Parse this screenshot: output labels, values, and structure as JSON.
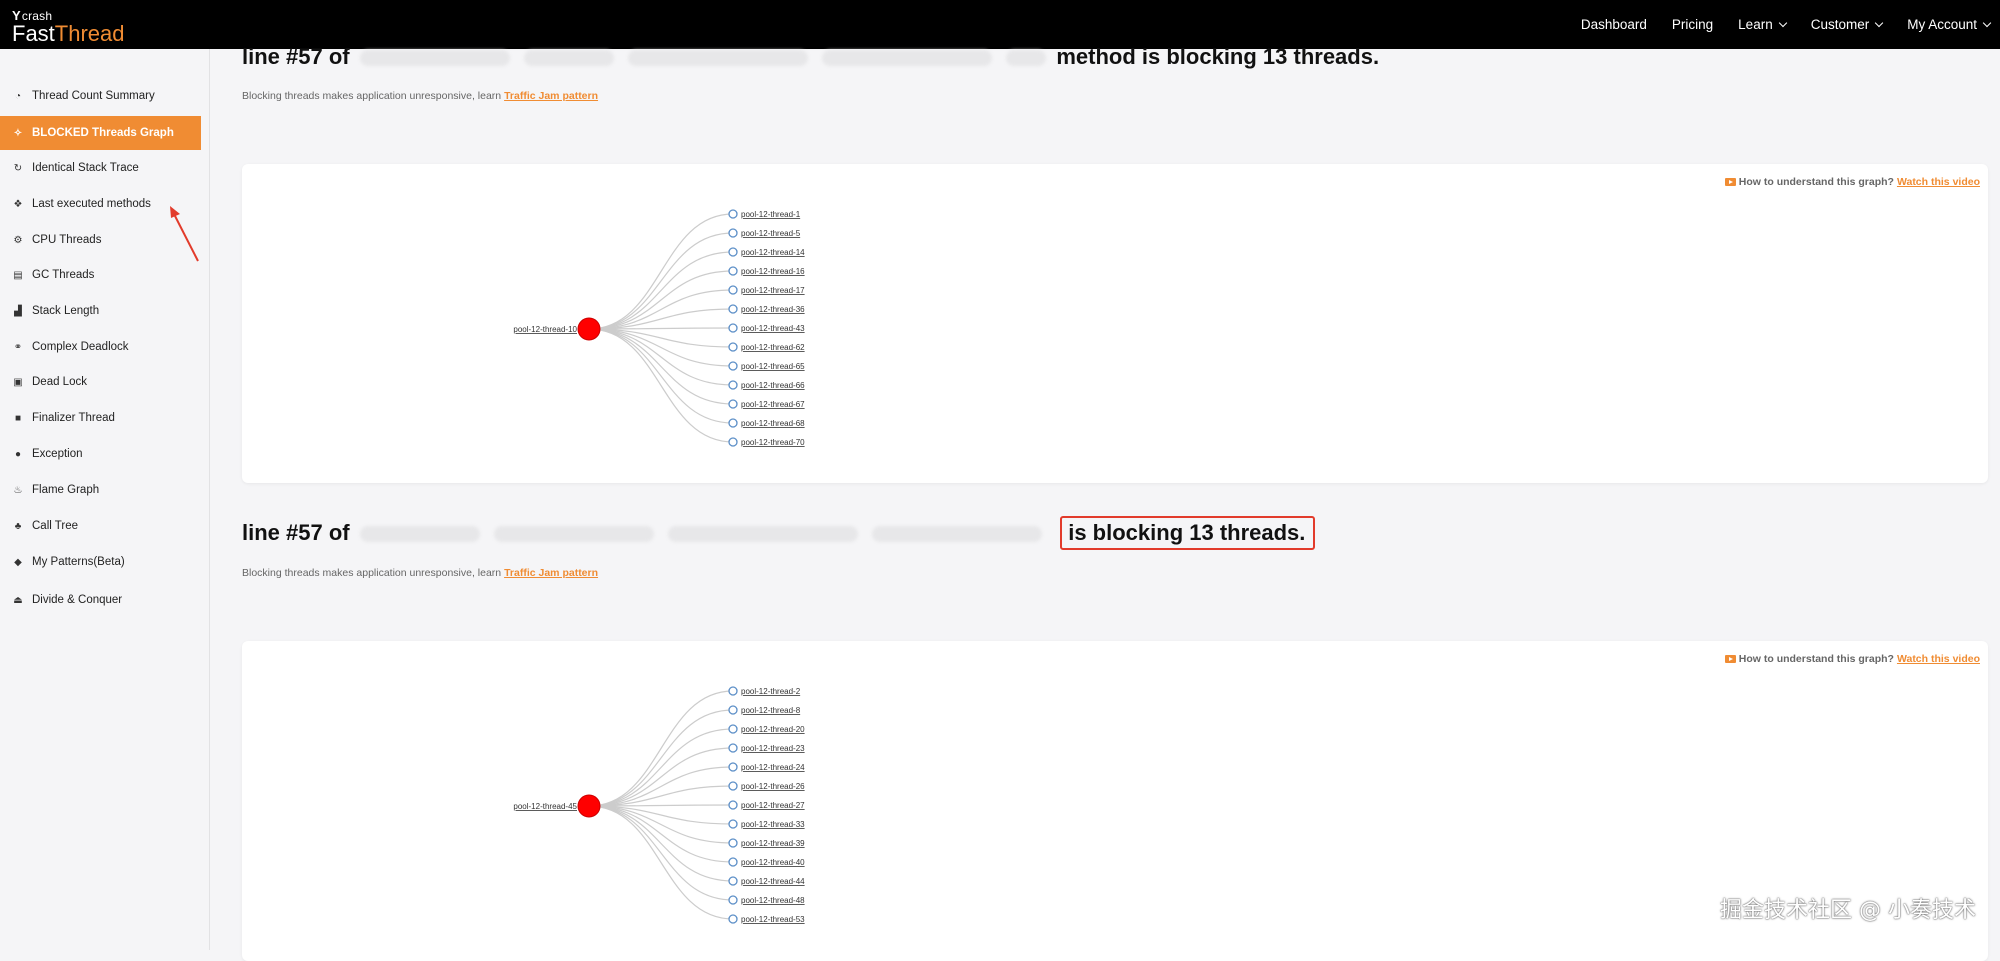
{
  "brand": {
    "small": "crash",
    "fast": "Fast",
    "thread": "Thread"
  },
  "nav": [
    {
      "label": "Dashboard",
      "dropdown": false
    },
    {
      "label": "Pricing",
      "dropdown": false
    },
    {
      "label": "Learn",
      "dropdown": true
    },
    {
      "label": "Customer",
      "dropdown": true
    },
    {
      "label": "My Account",
      "dropdown": true
    }
  ],
  "sidebar": {
    "active_index": 1,
    "items": [
      {
        "label": "Thread Count Summary",
        "icon": "dashboard-icon"
      },
      {
        "label": "BLOCKED Threads Graph",
        "icon": "graph-icon"
      },
      {
        "label": "Identical Stack Trace",
        "icon": "refresh-icon"
      },
      {
        "label": "Last executed methods",
        "icon": "cubes-icon"
      },
      {
        "label": "CPU Threads",
        "icon": "cogs-icon"
      },
      {
        "label": "GC Threads",
        "icon": "trash-icon"
      },
      {
        "label": "Stack Length",
        "icon": "bar-chart-icon"
      },
      {
        "label": "Complex Deadlock",
        "icon": "link-icon"
      },
      {
        "label": "Dead Lock",
        "icon": "lock-icon"
      },
      {
        "label": "Finalizer Thread",
        "icon": "square-icon"
      },
      {
        "label": "Exception",
        "icon": "alert-icon"
      },
      {
        "label": "Flame Graph",
        "icon": "flame-icon"
      },
      {
        "label": "Call Tree",
        "icon": "tree-icon"
      },
      {
        "label": "My Patterns(Beta)",
        "icon": "diamond-icon"
      },
      {
        "label": "Divide & Conquer",
        "icon": "sitemap-icon"
      }
    ]
  },
  "sections": [
    {
      "heading_prefix": "line #57 of",
      "heading_suffix": "method is blocking 13 threads.",
      "highlighted": false,
      "subtext": "Blocking threads makes application unresponsive, learn",
      "link": "Traffic Jam pattern",
      "howto": "How to understand this graph?",
      "howto_link": "Watch this video",
      "blocker": "pool-12-thread-10",
      "blocked": [
        "pool-12-thread-1",
        "pool-12-thread-5",
        "pool-12-thread-14",
        "pool-12-thread-16",
        "pool-12-thread-17",
        "pool-12-thread-36",
        "pool-12-thread-43",
        "pool-12-thread-62",
        "pool-12-thread-65",
        "pool-12-thread-66",
        "pool-12-thread-67",
        "pool-12-thread-68",
        "pool-12-thread-70"
      ]
    },
    {
      "heading_prefix": "line #57 of",
      "heading_suffix": "is blocking 13 threads.",
      "highlighted": true,
      "subtext": "Blocking threads makes application unresponsive, learn",
      "link": "Traffic Jam pattern",
      "howto": "How to understand this graph?",
      "howto_link": "Watch this video",
      "blocker": "pool-12-thread-45",
      "blocked": [
        "pool-12-thread-2",
        "pool-12-thread-8",
        "pool-12-thread-20",
        "pool-12-thread-23",
        "pool-12-thread-24",
        "pool-12-thread-26",
        "pool-12-thread-27",
        "pool-12-thread-33",
        "pool-12-thread-39",
        "pool-12-thread-40",
        "pool-12-thread-44",
        "pool-12-thread-48",
        "pool-12-thread-53"
      ]
    }
  ],
  "watermark": "掘金技术社区 @ 小奏技术",
  "colors": {
    "accent": "#f08c33",
    "blocker": "#ff0000",
    "highlight": "#e23b2b",
    "node_stroke": "#5b8ec7"
  }
}
